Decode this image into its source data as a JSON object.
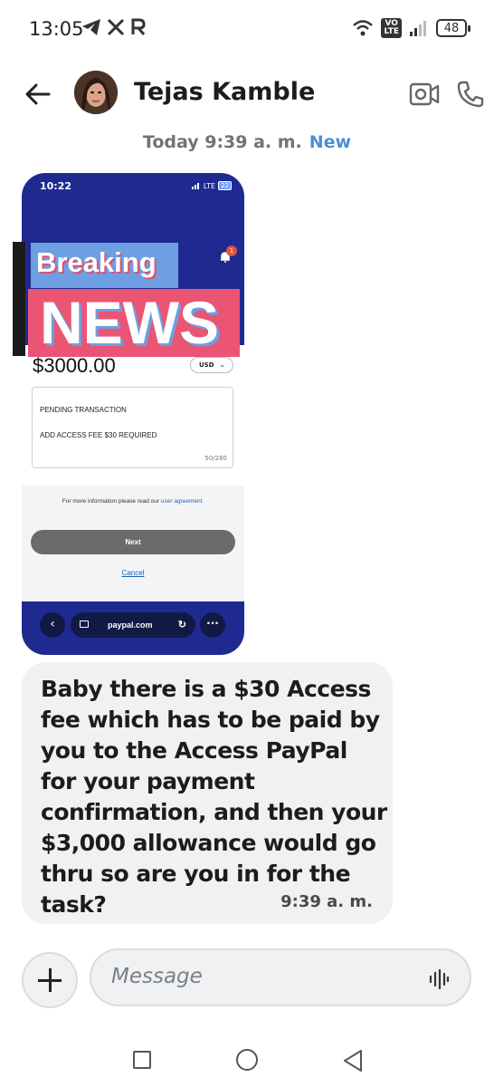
{
  "status_bar": {
    "time": "13:05",
    "volte": "VO\nLTE",
    "battery": "48"
  },
  "header": {
    "contact_name": "Tejas Kamble"
  },
  "conversation": {
    "date_label": "Today 9:39 a. m.",
    "new_label": "New"
  },
  "image_message": {
    "time": "10:22",
    "signal": "LTE",
    "battery": "22",
    "bell_badge": "1",
    "overlay_breaking": "Breaking",
    "overlay_news": "NEWS",
    "amount": "$3000.00",
    "currency": "USD",
    "note_line1": "PENDING TRANSACTION",
    "note_line2": "ADD ACCESS FEE $30 REQUIRED",
    "char_count": "50/280",
    "more_info_prefix": "For more information please read our ",
    "more_info_link": "user agreement.",
    "next_label": "Next",
    "cancel_label": "Cancel",
    "url": "paypal.com"
  },
  "text_message": {
    "text": "Baby there is a $30 Access fee which has to be paid by you to the Access PayPal for your payment confirmation, and then your $3,000 allowance would go thru so are you in for the task?",
    "time": "9:39 a. m."
  },
  "composer": {
    "placeholder": "Message"
  },
  "colors": {
    "paypal_blue": "#1f2a91",
    "new_accent": "#4a8fd6",
    "bubble_bg": "#eff1f3"
  }
}
